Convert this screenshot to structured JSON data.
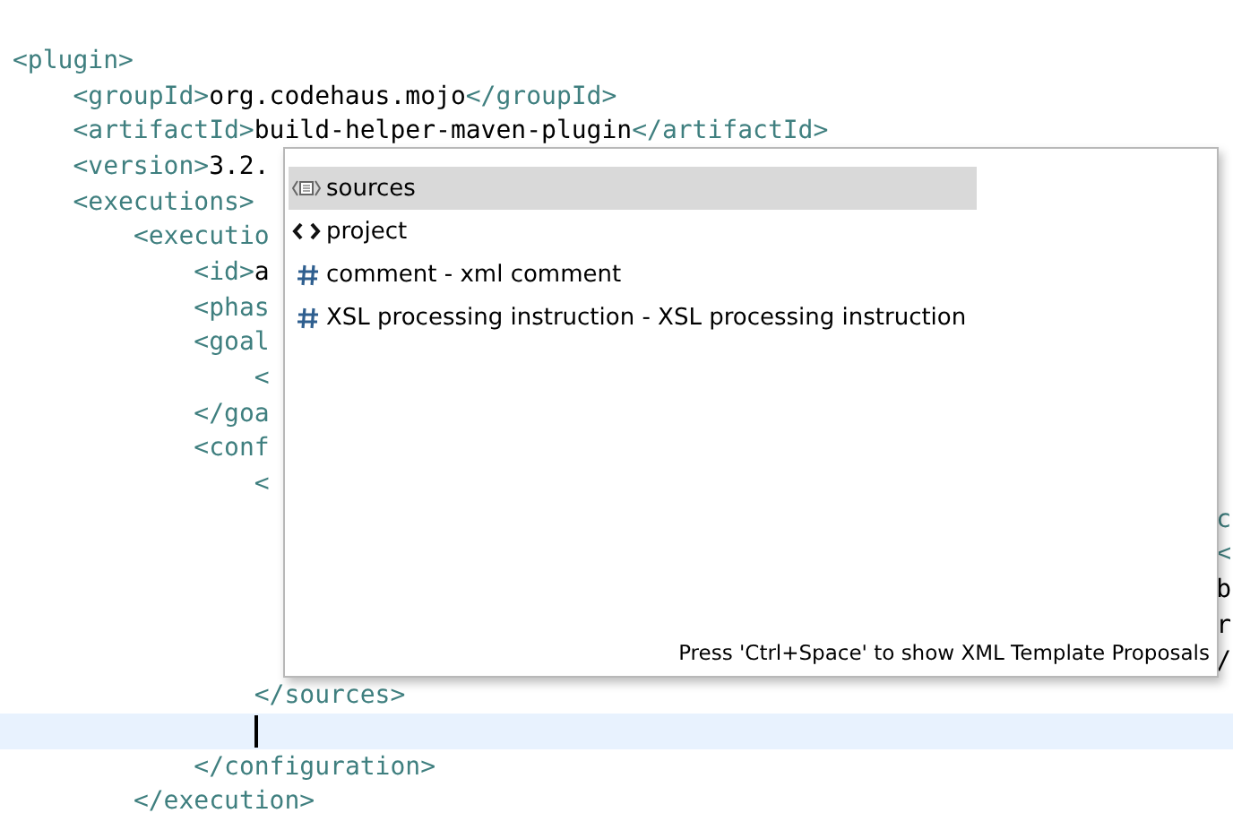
{
  "editor": {
    "lines": [
      {
        "text": "<plugin>",
        "current": false
      },
      {
        "text": "    <groupId>org.codehaus.mojo</groupId>",
        "current": false
      },
      {
        "text": "    <artifactId>build-helper-maven-plugin</artifactId>",
        "current": false
      },
      {
        "text": "    <version>3.2.",
        "current": false
      },
      {
        "text": "    <executions>",
        "current": false
      },
      {
        "text": "        <executio",
        "current": false
      },
      {
        "text": "            <id>a",
        "current": false
      },
      {
        "text": "            <phas",
        "current": false
      },
      {
        "text": "            <goal",
        "current": false
      },
      {
        "text": "                <",
        "current": false
      },
      {
        "text": "            </goa",
        "current": false
      },
      {
        "text": "            <conf",
        "current": false
      },
      {
        "text": "                <",
        "current": false
      },
      {
        "tail": {
          "text": "c",
          "kind": "tag"
        },
        "current": false
      },
      {
        "tail": {
          "text": "<",
          "kind": "tag"
        },
        "current": false
      },
      {
        "tail": {
          "text": "b",
          "kind": "content"
        },
        "current": false
      },
      {
        "tail": {
          "text": "r",
          "kind": "content"
        },
        "current": false
      },
      {
        "tail": {
          "text": "/",
          "kind": "content"
        },
        "current": false
      },
      {
        "text": "                </sources>",
        "current": false
      },
      {
        "current": true
      },
      {
        "text": "            </configuration>",
        "current": false
      },
      {
        "text": "        </execution>",
        "current": false
      }
    ]
  },
  "completion_popup": {
    "items": [
      {
        "label": "sources",
        "kind": "container",
        "selected": true
      },
      {
        "label": "project",
        "kind": "element",
        "selected": false
      },
      {
        "label": "comment - xml comment",
        "kind": "comment",
        "selected": false
      },
      {
        "label": "XSL processing instruction - XSL processing instruction",
        "kind": "instruction",
        "selected": false
      }
    ],
    "footer": "Press 'Ctrl+Space' to show XML Template Proposals"
  }
}
